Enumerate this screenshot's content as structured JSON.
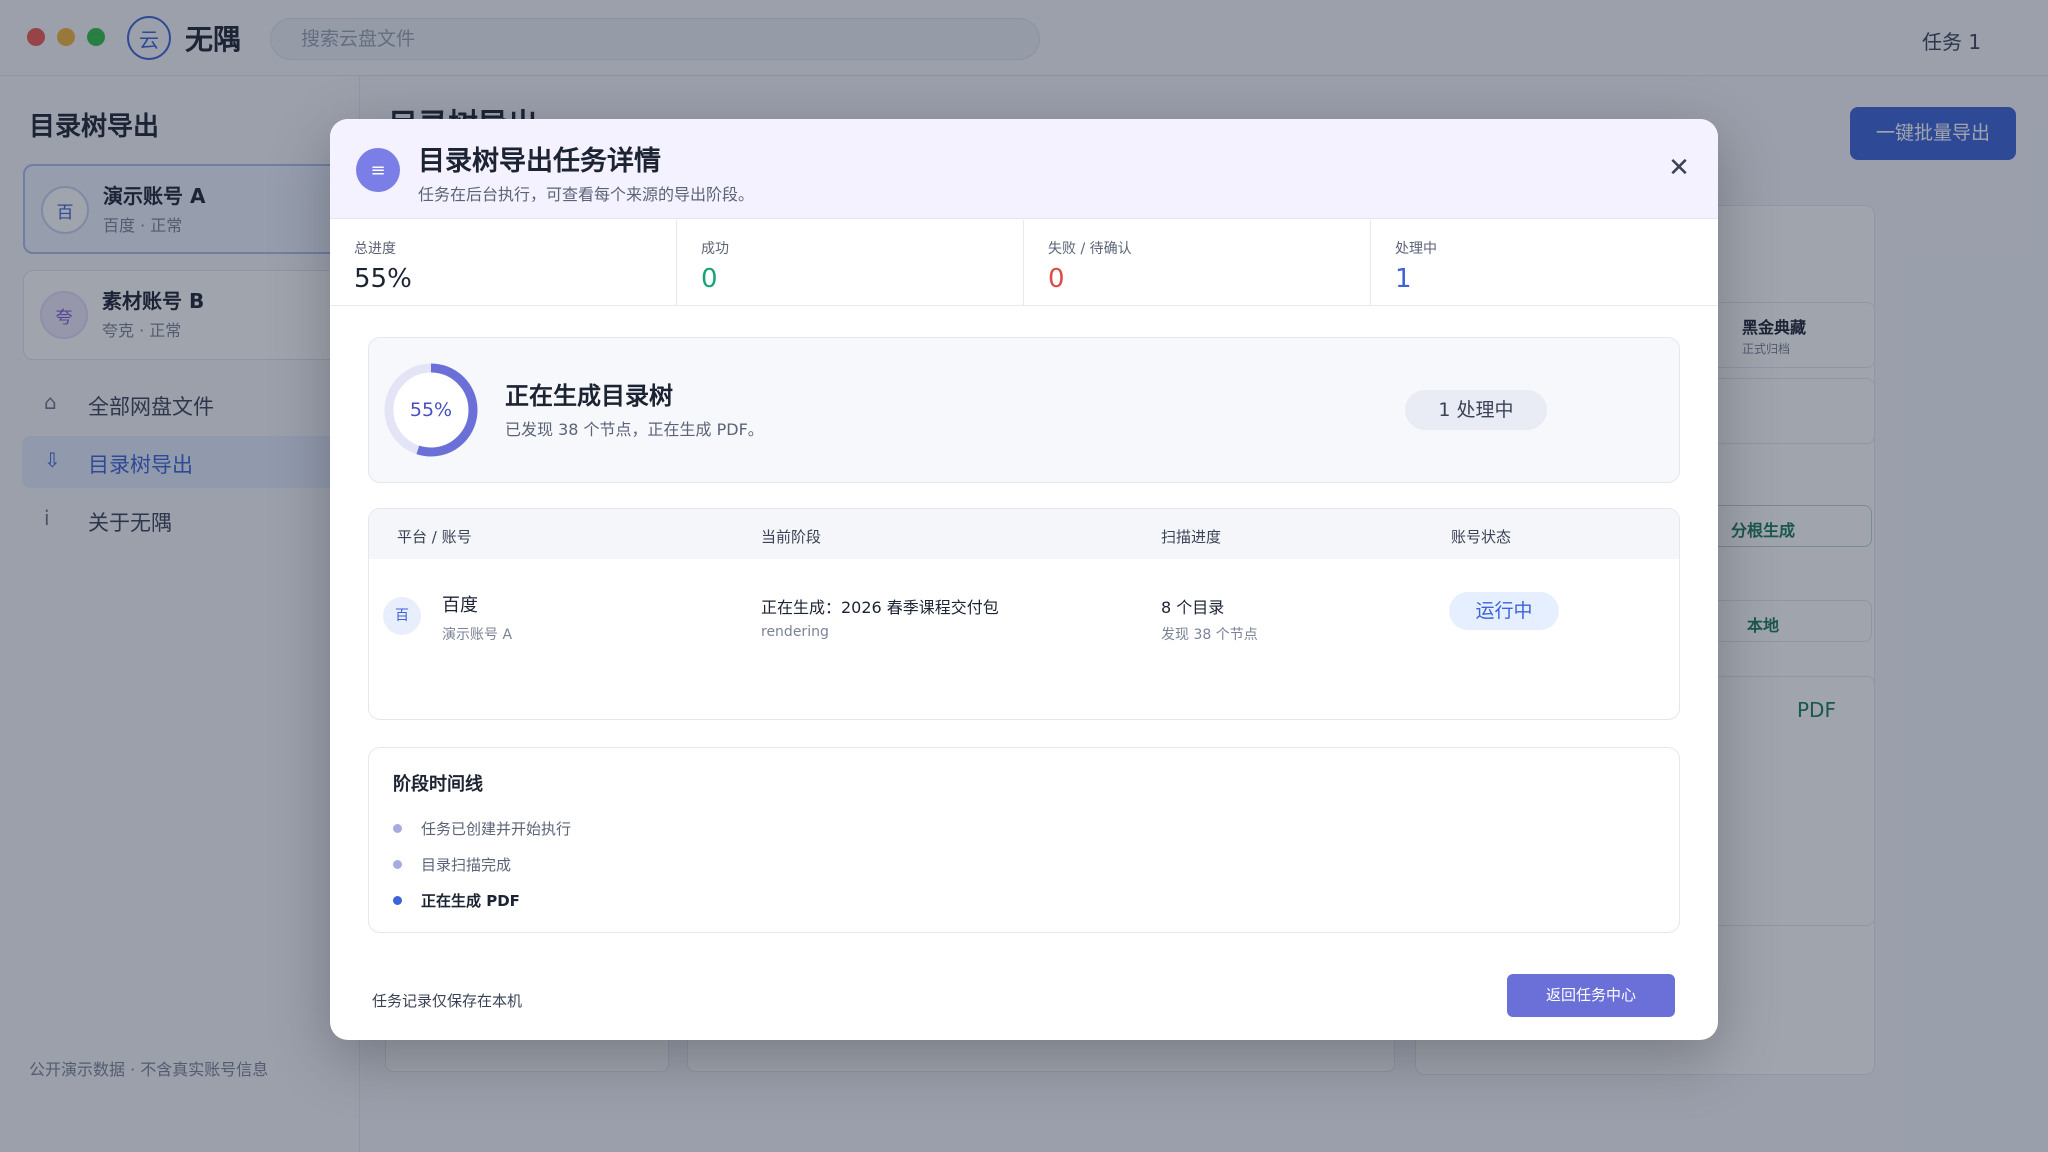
{
  "app": {
    "logo_glyph": "云",
    "name": "无隅",
    "search_placeholder": "搜索云盘文件",
    "tasks_label": "任务 1"
  },
  "sidebar": {
    "title": "目录树导出",
    "accounts": [
      {
        "avatar": "百",
        "name": "演示账号 A",
        "status": "百度 · 正常"
      },
      {
        "avatar": "夸",
        "name": "素材账号 B",
        "status": "夸克 · 正常"
      }
    ],
    "nav": [
      {
        "icon": "⌂",
        "label": "全部网盘文件"
      },
      {
        "icon": "⇩",
        "label": "目录树导出"
      },
      {
        "icon": "i",
        "label": "关于无隅"
      }
    ],
    "footer": "公开演示数据 · 不含真实账号信息"
  },
  "main": {
    "title": "目录树导出",
    "batch_button": "一键批量导出",
    "bg_labels": {
      "card_title": "黑金典藏",
      "card_sub": "正式归档",
      "option1": "分根生成",
      "option2": "本地",
      "format": "PDF"
    }
  },
  "modal": {
    "icon_glyph": "≡",
    "title": "目录树导出任务详情",
    "subtitle": "任务在后台执行，可查看每个来源的导出阶段。",
    "close_glyph": "✕",
    "stats": [
      {
        "label": "总进度",
        "value": "55%"
      },
      {
        "label": "成功",
        "value": "0"
      },
      {
        "label": "失败 / 待确认",
        "value": "0"
      },
      {
        "label": "处理中",
        "value": "1"
      }
    ],
    "progress": {
      "percent": 55,
      "percent_text": "55%",
      "title": "正在生成目录树",
      "subtitle": "已发现 38 个节点，正在生成 PDF。",
      "badge": "1 处理中"
    },
    "table": {
      "headers": [
        "平台 / 账号",
        "当前阶段",
        "扫描进度",
        "账号状态"
      ],
      "rows": [
        {
          "avatar": "百",
          "platform": "百度",
          "account": "演示账号 A",
          "stage": "正在生成：2026 春季课程交付包",
          "stage_code": "rendering",
          "scan": "8 个目录",
          "scan_sub": "发现 38 个节点",
          "status": "运行中"
        }
      ]
    },
    "timeline": {
      "title": "阶段时间线",
      "items": [
        {
          "text": "任务已创建并开始执行",
          "current": false
        },
        {
          "text": "目录扫描完成",
          "current": false
        },
        {
          "text": "正在生成 PDF",
          "current": true
        }
      ]
    },
    "footer_note": "任务记录仅保存在本机",
    "return_button": "返回任务中心"
  },
  "colors": {
    "accent": "#3c63d8",
    "modal_accent": "#6b70d8",
    "success": "#1aa37a",
    "danger": "#e04a4a"
  }
}
